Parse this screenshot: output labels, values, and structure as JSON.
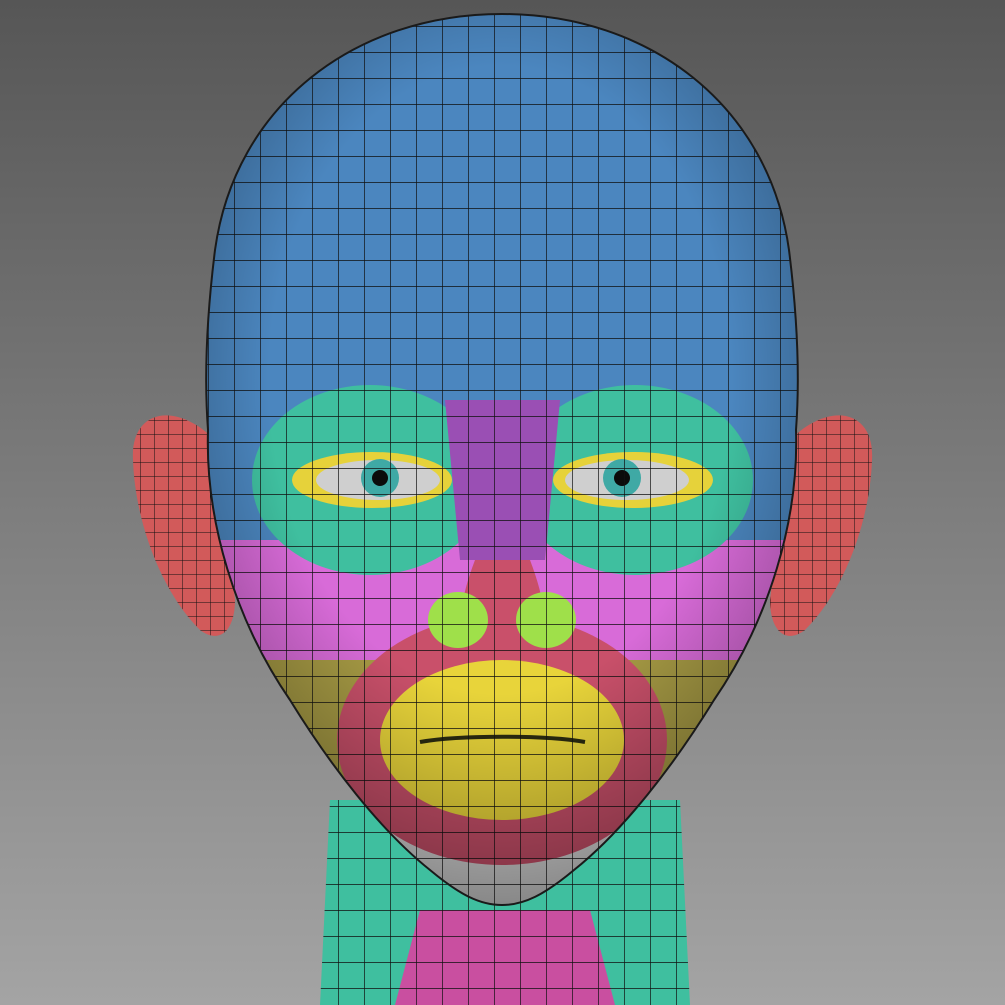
{
  "render": {
    "subject": "head-topology-mesh",
    "background": {
      "top": "#565656",
      "bottom": "#a4a4a4"
    },
    "wireframe_color": "#101010",
    "zones": {
      "cranium": "#4b86bf",
      "eye_socket": "#3fbf9f",
      "eyelid": "#e6d23a",
      "iris": "#3fa9a5",
      "sclera": "#cfcfcf",
      "brow_and_nose_bridge": "#9a4fb4",
      "nose_and_cheek_band": "#d86bd8",
      "nostril": "#9fe04a",
      "lip_ring": "#c9506a",
      "mouth": "#e8d43a",
      "jaw_sides": "#a69a44",
      "chin_band": "#d8d8d8",
      "ear": "#d25a5a",
      "neck": "#3fbf9f",
      "neck_front": "#c94fa0"
    }
  }
}
